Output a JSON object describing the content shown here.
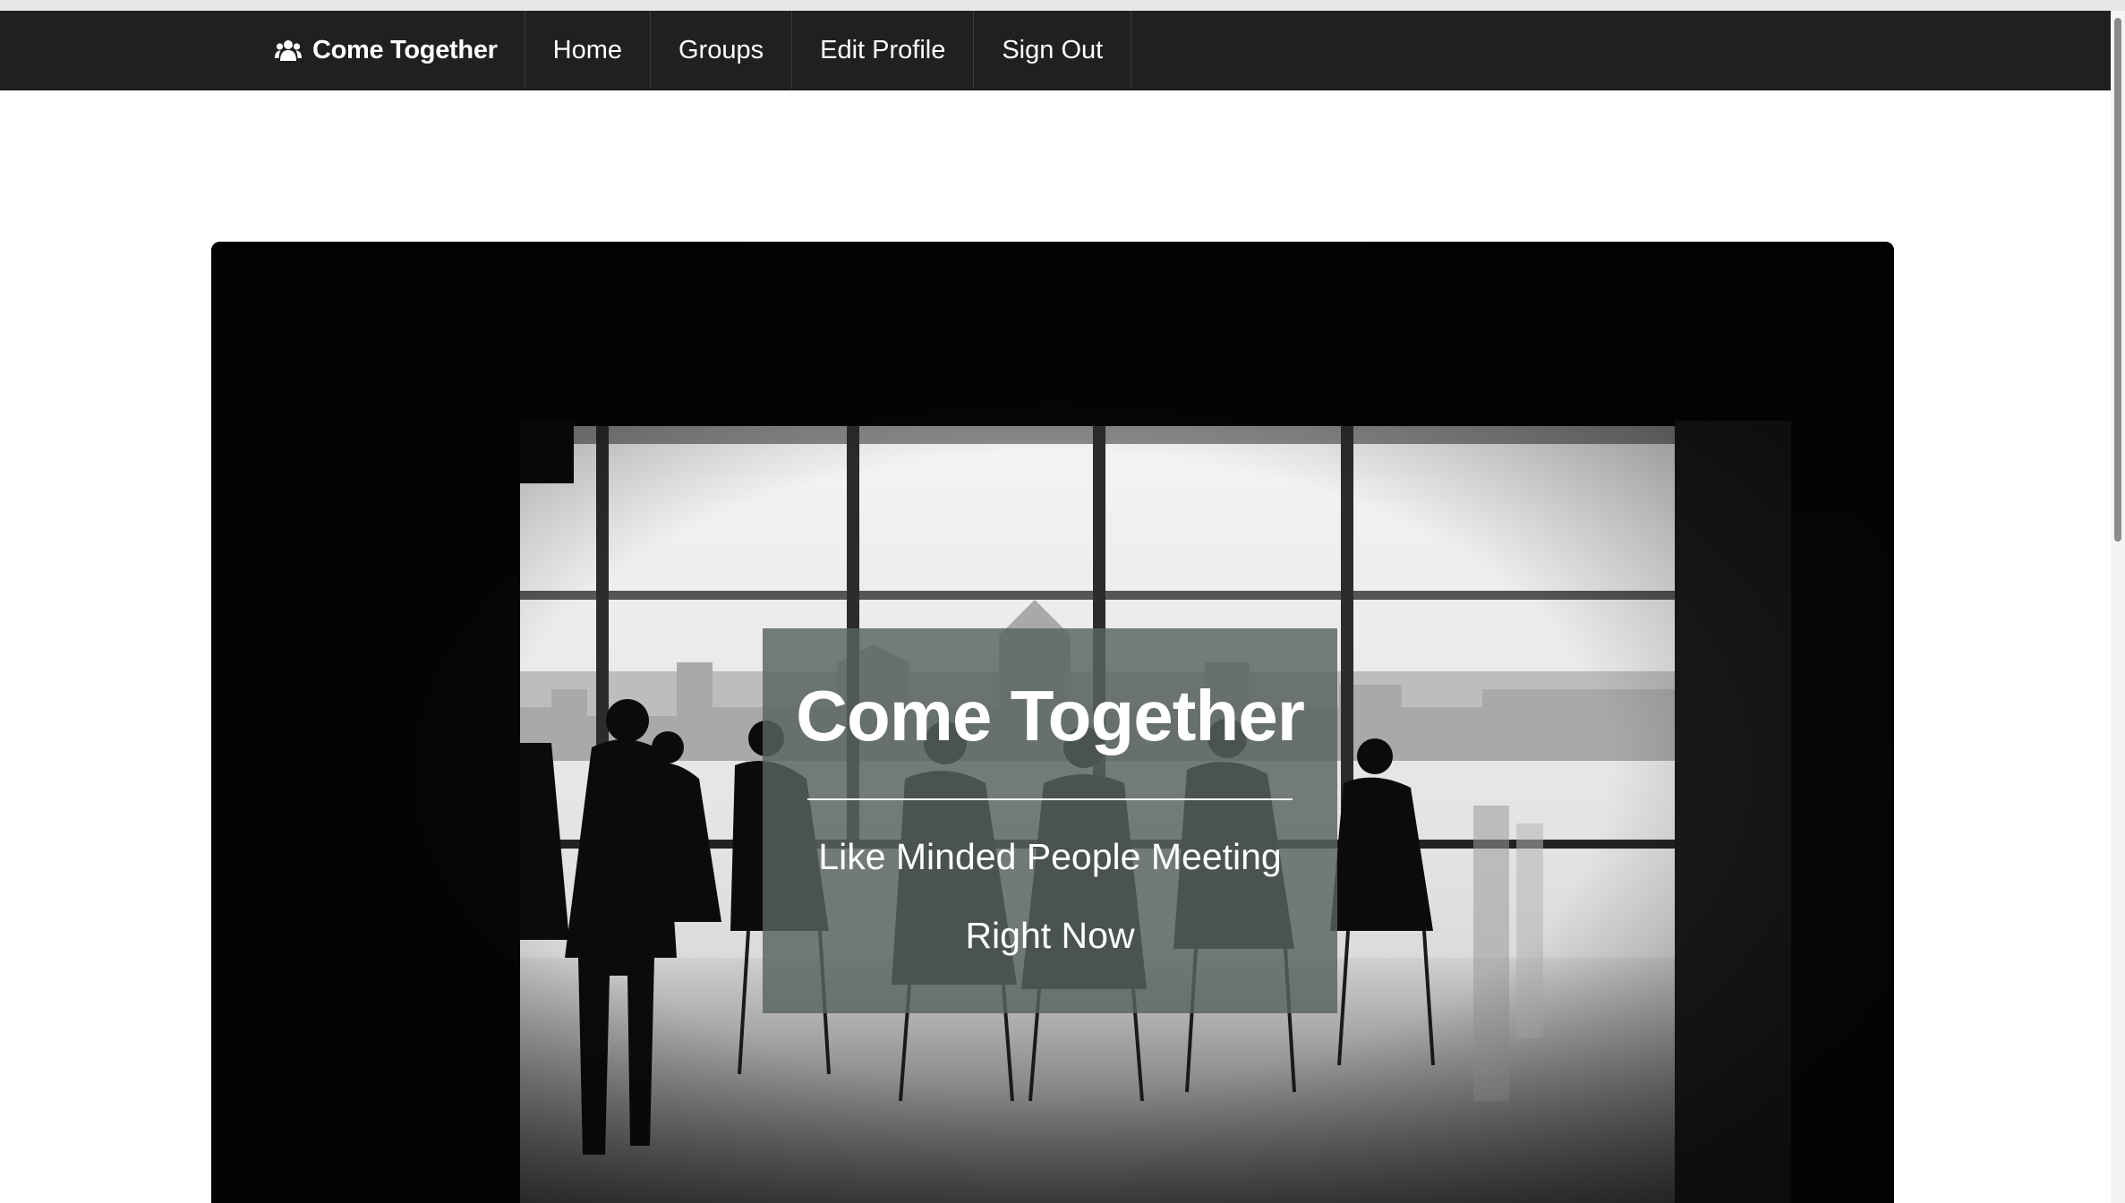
{
  "nav": {
    "brand": "Come Together",
    "brand_icon": "users-icon",
    "items": [
      {
        "label": "Home"
      },
      {
        "label": "Groups"
      },
      {
        "label": "Edit Profile"
      },
      {
        "label": "Sign Out"
      }
    ]
  },
  "hero": {
    "image": "silhouettes-meeting-room-photo",
    "title": "Come Together",
    "tagline_line1": "Like Minded People Meeting",
    "tagline_line2": "Right Now"
  },
  "colors": {
    "navbar": "#1f2022",
    "caption_overlay": "#586262",
    "text": "#ffffff"
  }
}
